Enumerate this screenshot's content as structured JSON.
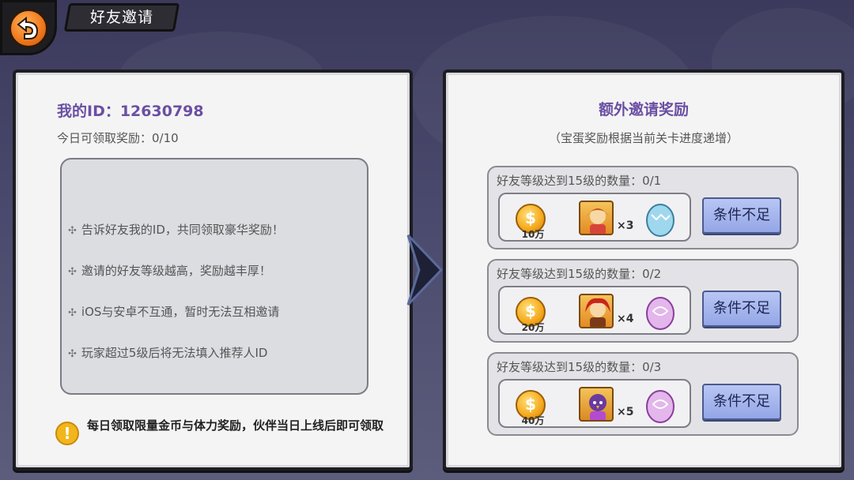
{
  "header": {
    "title": "好友邀请"
  },
  "left_panel": {
    "my_id_label": "我的ID：12630798",
    "today_reward": "今日可领取奖励：0/10",
    "tips": [
      "告诉好友我的ID，共同领取豪华奖励！",
      "邀请的好友等级越高，奖励越丰厚！",
      "iOS与安卓不互通，暂时无法互相邀请",
      "玩家超过5级后将无法填入推荐人ID"
    ],
    "notice_icon": "!",
    "notice": "每日领取限量金币与体力奖励，伙伴当日上线后即可领取"
  },
  "right_panel": {
    "title": "额外邀请奖励",
    "subtitle": "（宝蛋奖励根据当前关卡进度递增）",
    "cards": [
      {
        "label": "好友等级达到15级的数量：0/1",
        "coin_amount": "10万",
        "hero_qty": "×3",
        "egg_color": "#9fd8ee",
        "button": "条件不足"
      },
      {
        "label": "好友等级达到15级的数量：0/2",
        "coin_amount": "20万",
        "hero_qty": "×4",
        "egg_color": "#e3b6ec",
        "button": "条件不足"
      },
      {
        "label": "好友等级达到15级的数量：0/3",
        "coin_amount": "40万",
        "hero_qty": "×5",
        "egg_color": "#e3b6ec",
        "button": "条件不足"
      }
    ]
  },
  "colors": {
    "accent_purple": "#6a4fa3",
    "button_blue": "#a5b4ee",
    "coin_gold": "#f5a91c"
  }
}
